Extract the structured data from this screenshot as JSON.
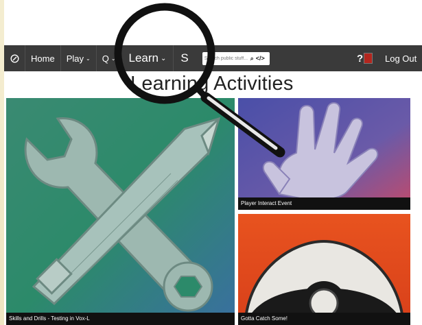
{
  "nav": {
    "home_label": "Home",
    "play_label": "Play",
    "quest_label": "Q",
    "learn_label": "Learn",
    "s_label": "S",
    "search_placeholder": "Search public stuff...",
    "help_label": "?",
    "logout_label": "Log Out"
  },
  "page_title": "Learning Activities",
  "cards": [
    {
      "caption": "Skills and Drills - Testing in Vox-L",
      "icon": "wrench-pencil-icon"
    },
    {
      "caption": "Player Interact Event",
      "icon": "hand-print-icon"
    },
    {
      "caption": "Gotta Catch Some!",
      "icon": "pokeball-icon"
    }
  ],
  "colors": {
    "navbar": "#3a3a3a",
    "parchment": "#efe6c2",
    "card_green": "#2c8a6a",
    "card_purple": "#5a4f9a",
    "card_orange": "#e04a1f"
  }
}
